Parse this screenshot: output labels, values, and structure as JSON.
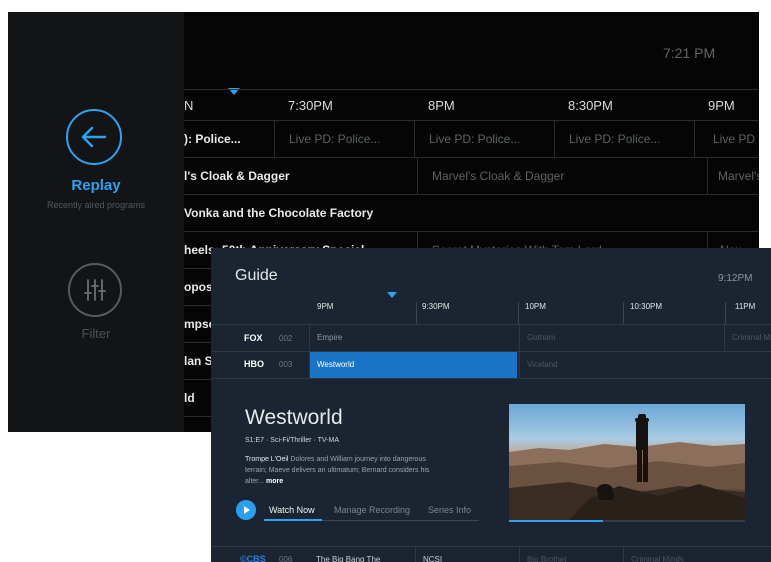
{
  "back_window": {
    "time": "7:21 PM",
    "sidebar": {
      "replay_label": "Replay",
      "replay_subtitle": "Recently aired programs",
      "filter_label": "Filter"
    },
    "timeline": [
      "N",
      "7:30PM",
      "8PM",
      "8:30PM",
      "9PM"
    ],
    "rows": [
      {
        "cells": [
          "): Police...",
          "Live PD: Police...",
          "Live PD: Police...",
          "Live PD: Police...",
          "Live PD"
        ]
      },
      {
        "cells": [
          "l's Cloak & Dagger",
          "Marvel's Cloak & Dagger",
          "Marvel's"
        ]
      },
      {
        "cells": [
          "Vonka and the Chocolate Factory"
        ]
      },
      {
        "cells": [
          "heels: 50th Anniversary Special",
          "Secret Mysteries With Tom Lord",
          "Alex"
        ]
      },
      {
        "cells": [
          "opos"
        ]
      },
      {
        "cells": [
          "mpso"
        ]
      },
      {
        "cells": [
          "lan S"
        ]
      },
      {
        "cells": [
          "ld"
        ]
      }
    ]
  },
  "guide": {
    "title": "Guide",
    "time": "9:12PM",
    "timeline": [
      "9PM",
      "9:30PM",
      "10PM",
      "10:30PM",
      "11PM"
    ],
    "channels": [
      {
        "logo": "FOX",
        "number": "002",
        "programs": [
          "Empire",
          "Gotham",
          "Criminal Minds"
        ]
      },
      {
        "logo": "HBO",
        "number": "003",
        "programs": [
          "Westworld",
          "Viceland"
        ]
      },
      {
        "logo": "©CBS",
        "number": "006",
        "programs": [
          "The Big Bang The",
          "NCSI",
          "Big Brother",
          "Criminal Minds"
        ]
      }
    ],
    "detail": {
      "title": "Westworld",
      "meta": "S1:E7 · Sci-Fi/Thriller · TV-MA",
      "episode": "Trompe L'Oeil",
      "description": " Dolores and William journey into dangerous terrain; Maeve delivers an ultimatum; Bernard considers his alter...",
      "more": " more",
      "progress": 0.4
    },
    "actions": {
      "watch_now": "Watch Now",
      "manage_recording": "Manage Recording",
      "series_info": "Series Info"
    }
  },
  "colors": {
    "accent": "#2aa3f0",
    "selected_row": "#1a74c5",
    "guide_bg": "#1a2531",
    "back_bg": "#050505"
  }
}
